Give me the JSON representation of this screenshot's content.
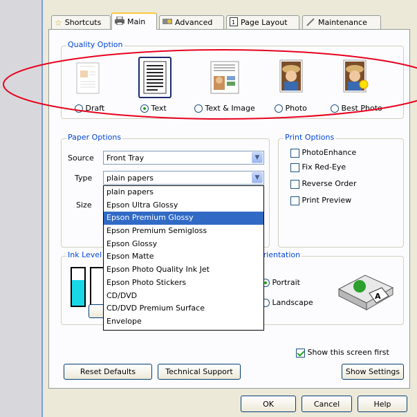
{
  "tabs": [
    {
      "label": "Shortcuts",
      "icon": "star-icon"
    },
    {
      "label": "Main",
      "icon": "printer-icon"
    },
    {
      "label": "Advanced",
      "icon": "advanced-icon"
    },
    {
      "label": "Page Layout",
      "icon": "page-layout-icon"
    },
    {
      "label": "Maintenance",
      "icon": "wrench-icon"
    }
  ],
  "quality": {
    "legend": "Quality Option",
    "options": [
      {
        "label": "Draft",
        "selected": false
      },
      {
        "label": "Text",
        "selected": true
      },
      {
        "label": "Text & Image",
        "selected": false
      },
      {
        "label": "Photo",
        "selected": false
      },
      {
        "label": "Best Photo",
        "selected": false
      }
    ]
  },
  "paper": {
    "legend": "Paper Options",
    "source_label": "Source",
    "source_value": "Front Tray",
    "type_label": "Type",
    "type_value": "plain papers",
    "size_label": "Size",
    "type_options": [
      "plain papers",
      "Epson Ultra Glossy",
      "Epson Premium Glossy",
      "Epson Premium Semigloss",
      "Epson Glossy",
      "Epson Matte",
      "Epson Photo Quality Ink Jet",
      "Epson Photo Stickers",
      "CD/DVD",
      "CD/DVD Premium Surface",
      "Envelope"
    ],
    "highlighted": "Epson Premium Glossy"
  },
  "print_options": {
    "legend": "Print Options",
    "items": [
      {
        "label": "PhotoEnhance",
        "checked": false
      },
      {
        "label": "Fix Red-Eye",
        "checked": false
      },
      {
        "label": "Reverse Order",
        "checked": false
      },
      {
        "label": "Print Preview",
        "checked": false
      }
    ]
  },
  "ink": {
    "legend": "Ink Level"
  },
  "orientation": {
    "legend": "Orientation",
    "portrait": "Portrait",
    "landscape": "Landscape",
    "selected": "Portrait"
  },
  "show_first": {
    "label": "Show this screen first",
    "checked": true
  },
  "buttons": {
    "reset": "Reset Defaults",
    "support": "Technical Support",
    "settings": "Show Settings",
    "ok": "OK",
    "cancel": "Cancel",
    "help": "Help"
  },
  "colors": {
    "highlight": "#316ac5",
    "annotation": "#e8001c",
    "ink_cyan": "#18d8e8"
  }
}
